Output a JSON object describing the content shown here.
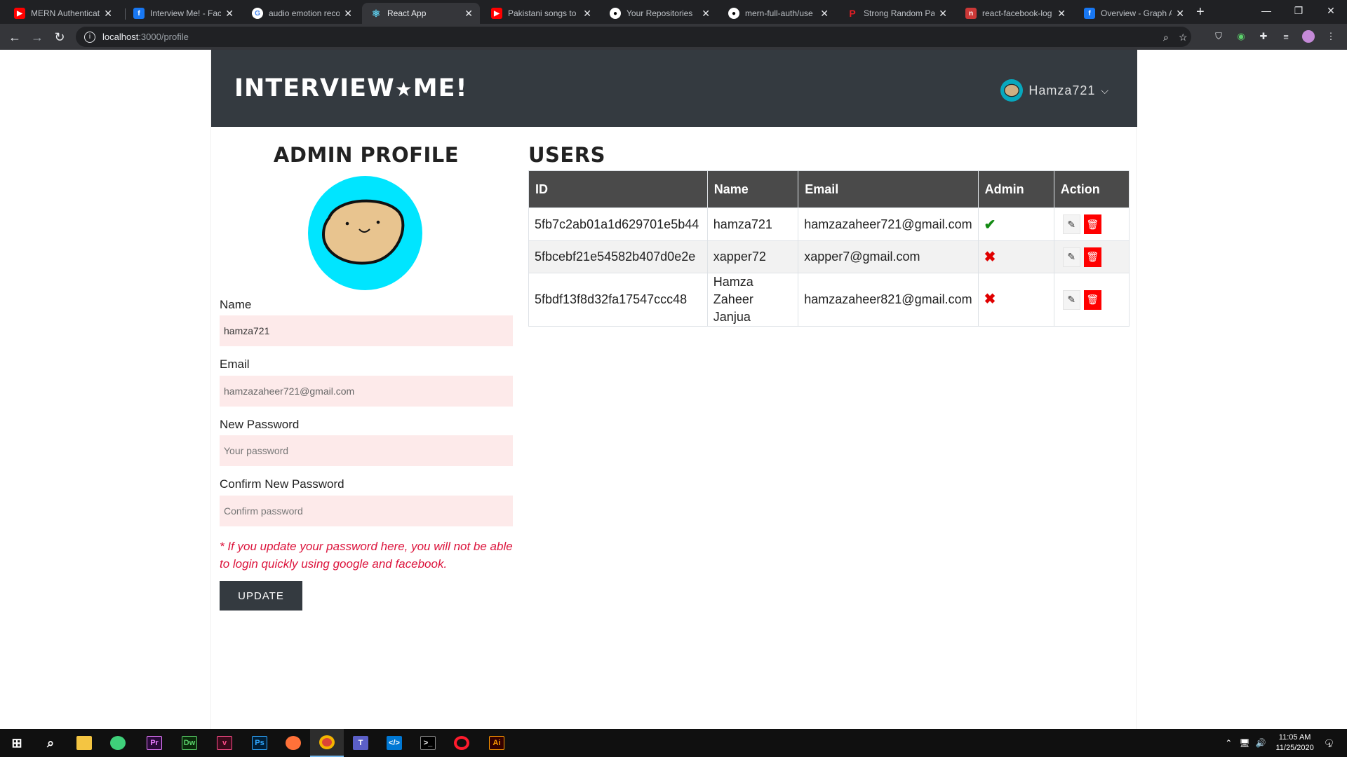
{
  "browser": {
    "tabs": [
      {
        "title": "MERN Authenticati",
        "icon": "youtube-icon",
        "color": "#ff0000"
      },
      {
        "title": "Interview Me! - Face",
        "icon": "facebook-icon",
        "color": "#1877f2"
      },
      {
        "title": "audio emotion reco",
        "icon": "google-icon",
        "color": "#ffffff"
      },
      {
        "title": "React App",
        "icon": "react-icon",
        "color": "#61dafb",
        "active": true
      },
      {
        "title": "Pakistani songs to li",
        "icon": "youtube-icon",
        "color": "#ff0000"
      },
      {
        "title": "Your Repositories",
        "icon": "github-icon",
        "color": "#ffffff"
      },
      {
        "title": "mern-full-auth/use",
        "icon": "github-icon",
        "color": "#ffffff"
      },
      {
        "title": "Strong Random Pa",
        "icon": "password-generator-icon",
        "color": "#e31e24"
      },
      {
        "title": "react-facebook-log",
        "icon": "npm-icon",
        "color": "#cb3837"
      },
      {
        "title": "Overview - Graph A",
        "icon": "facebook-icon",
        "color": "#1877f2"
      }
    ],
    "url_host": "localhost",
    "url_path": ":3000/profile"
  },
  "app": {
    "brand": "INTERVIEW",
    "brand_star": "★",
    "brand_suffix": "ME!",
    "user_menu_label": "Hamza721"
  },
  "profile": {
    "title": "ADMIN PROFILE",
    "name_label": "Name",
    "name_value": "hamza721",
    "email_label": "Email",
    "email_value": "hamzazaheer721@gmail.com",
    "new_password_label": "New Password",
    "new_password_placeholder": "Your password",
    "confirm_password_label": "Confirm New Password",
    "confirm_password_placeholder": "Confirm password",
    "note": "* If you update your password here, you will not be able to login quickly using google and facebook.",
    "update_label": "UPDATE"
  },
  "users": {
    "title": "USERS",
    "columns": [
      "ID",
      "Name",
      "Email",
      "Admin",
      "Action"
    ],
    "rows": [
      {
        "id": "5fb7c2ab01a1d629701e5b44",
        "name": "hamza721",
        "email": "hamzazaheer721@gmail.com",
        "admin": true
      },
      {
        "id": "5fbcebf21e54582b407d0e2e",
        "name": "xapper72",
        "email": "xapper7@gmail.com",
        "admin": false
      },
      {
        "id": "5fbdf13f8d32fa17547ccc48",
        "name": "Hamza Zaheer Janjua",
        "email": "hamzazaheer821@gmail.com",
        "admin": false
      }
    ]
  },
  "taskbar": {
    "time": "11:05 AM",
    "date": "11/25/2020",
    "notification_count": "1"
  },
  "colors": {
    "header_bg": "#343a40",
    "table_header_bg": "#4a4a4a",
    "input_bg": "#fdeaea",
    "note_color": "#dc143c",
    "avatar_bg": "#00e5ff",
    "delete_red": "#ff0000",
    "admin_check": "#138a13"
  }
}
